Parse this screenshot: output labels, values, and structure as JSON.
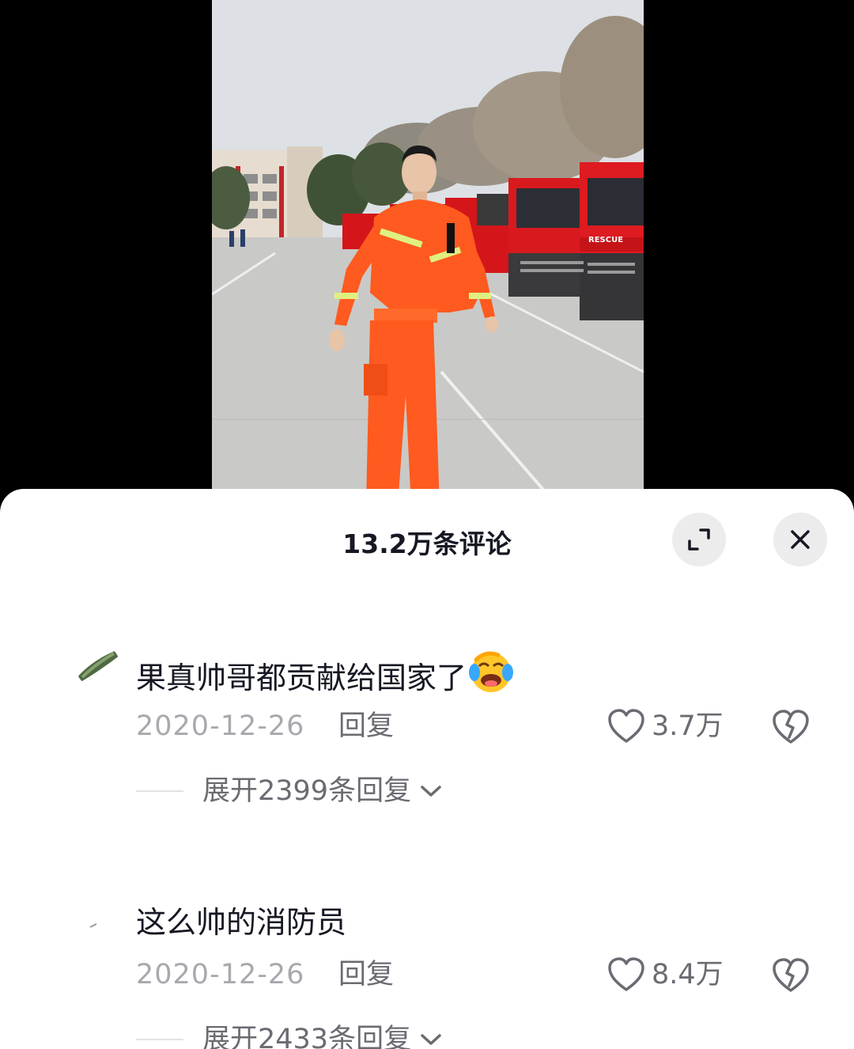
{
  "video": {
    "truck_badge_text": "RESCUE"
  },
  "comments_panel": {
    "title": "13.2万条评论",
    "expand_icon": "expand-icon",
    "close_icon": "close-icon"
  },
  "comments": [
    {
      "text": "果真帅哥都贡献给国家了",
      "emoji": "laughing-crying-emoji",
      "date": "2020-12-26",
      "reply_label": "回复",
      "likes": "3.7万",
      "expand_replies": "展开2399条回复"
    },
    {
      "text": "这么帅的消防员",
      "date": "2020-12-26",
      "reply_label": "回复",
      "likes": "8.4万",
      "expand_replies": "展开2433条回复"
    }
  ],
  "colors": {
    "uniform_orange": "#ff5a1f",
    "truck_red": "#d4161b",
    "text_primary": "#161823",
    "text_secondary": "#a8a9ae"
  }
}
